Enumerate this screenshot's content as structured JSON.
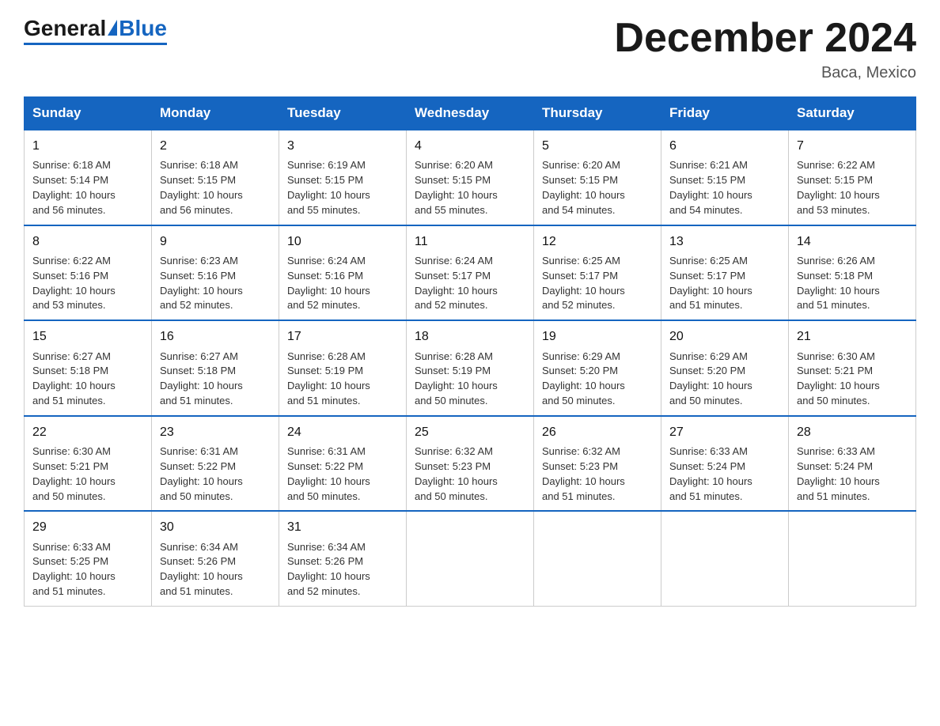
{
  "header": {
    "logo_general": "General",
    "logo_blue": "Blue",
    "month_title": "December 2024",
    "location": "Baca, Mexico"
  },
  "days_of_week": [
    "Sunday",
    "Monday",
    "Tuesday",
    "Wednesday",
    "Thursday",
    "Friday",
    "Saturday"
  ],
  "weeks": [
    [
      {
        "day": "1",
        "sunrise": "6:18 AM",
        "sunset": "5:14 PM",
        "daylight": "10 hours and 56 minutes."
      },
      {
        "day": "2",
        "sunrise": "6:18 AM",
        "sunset": "5:15 PM",
        "daylight": "10 hours and 56 minutes."
      },
      {
        "day": "3",
        "sunrise": "6:19 AM",
        "sunset": "5:15 PM",
        "daylight": "10 hours and 55 minutes."
      },
      {
        "day": "4",
        "sunrise": "6:20 AM",
        "sunset": "5:15 PM",
        "daylight": "10 hours and 55 minutes."
      },
      {
        "day": "5",
        "sunrise": "6:20 AM",
        "sunset": "5:15 PM",
        "daylight": "10 hours and 54 minutes."
      },
      {
        "day": "6",
        "sunrise": "6:21 AM",
        "sunset": "5:15 PM",
        "daylight": "10 hours and 54 minutes."
      },
      {
        "day": "7",
        "sunrise": "6:22 AM",
        "sunset": "5:15 PM",
        "daylight": "10 hours and 53 minutes."
      }
    ],
    [
      {
        "day": "8",
        "sunrise": "6:22 AM",
        "sunset": "5:16 PM",
        "daylight": "10 hours and 53 minutes."
      },
      {
        "day": "9",
        "sunrise": "6:23 AM",
        "sunset": "5:16 PM",
        "daylight": "10 hours and 52 minutes."
      },
      {
        "day": "10",
        "sunrise": "6:24 AM",
        "sunset": "5:16 PM",
        "daylight": "10 hours and 52 minutes."
      },
      {
        "day": "11",
        "sunrise": "6:24 AM",
        "sunset": "5:17 PM",
        "daylight": "10 hours and 52 minutes."
      },
      {
        "day": "12",
        "sunrise": "6:25 AM",
        "sunset": "5:17 PM",
        "daylight": "10 hours and 52 minutes."
      },
      {
        "day": "13",
        "sunrise": "6:25 AM",
        "sunset": "5:17 PM",
        "daylight": "10 hours and 51 minutes."
      },
      {
        "day": "14",
        "sunrise": "6:26 AM",
        "sunset": "5:18 PM",
        "daylight": "10 hours and 51 minutes."
      }
    ],
    [
      {
        "day": "15",
        "sunrise": "6:27 AM",
        "sunset": "5:18 PM",
        "daylight": "10 hours and 51 minutes."
      },
      {
        "day": "16",
        "sunrise": "6:27 AM",
        "sunset": "5:18 PM",
        "daylight": "10 hours and 51 minutes."
      },
      {
        "day": "17",
        "sunrise": "6:28 AM",
        "sunset": "5:19 PM",
        "daylight": "10 hours and 51 minutes."
      },
      {
        "day": "18",
        "sunrise": "6:28 AM",
        "sunset": "5:19 PM",
        "daylight": "10 hours and 50 minutes."
      },
      {
        "day": "19",
        "sunrise": "6:29 AM",
        "sunset": "5:20 PM",
        "daylight": "10 hours and 50 minutes."
      },
      {
        "day": "20",
        "sunrise": "6:29 AM",
        "sunset": "5:20 PM",
        "daylight": "10 hours and 50 minutes."
      },
      {
        "day": "21",
        "sunrise": "6:30 AM",
        "sunset": "5:21 PM",
        "daylight": "10 hours and 50 minutes."
      }
    ],
    [
      {
        "day": "22",
        "sunrise": "6:30 AM",
        "sunset": "5:21 PM",
        "daylight": "10 hours and 50 minutes."
      },
      {
        "day": "23",
        "sunrise": "6:31 AM",
        "sunset": "5:22 PM",
        "daylight": "10 hours and 50 minutes."
      },
      {
        "day": "24",
        "sunrise": "6:31 AM",
        "sunset": "5:22 PM",
        "daylight": "10 hours and 50 minutes."
      },
      {
        "day": "25",
        "sunrise": "6:32 AM",
        "sunset": "5:23 PM",
        "daylight": "10 hours and 50 minutes."
      },
      {
        "day": "26",
        "sunrise": "6:32 AM",
        "sunset": "5:23 PM",
        "daylight": "10 hours and 51 minutes."
      },
      {
        "day": "27",
        "sunrise": "6:33 AM",
        "sunset": "5:24 PM",
        "daylight": "10 hours and 51 minutes."
      },
      {
        "day": "28",
        "sunrise": "6:33 AM",
        "sunset": "5:24 PM",
        "daylight": "10 hours and 51 minutes."
      }
    ],
    [
      {
        "day": "29",
        "sunrise": "6:33 AM",
        "sunset": "5:25 PM",
        "daylight": "10 hours and 51 minutes."
      },
      {
        "day": "30",
        "sunrise": "6:34 AM",
        "sunset": "5:26 PM",
        "daylight": "10 hours and 51 minutes."
      },
      {
        "day": "31",
        "sunrise": "6:34 AM",
        "sunset": "5:26 PM",
        "daylight": "10 hours and 52 minutes."
      },
      null,
      null,
      null,
      null
    ]
  ],
  "labels": {
    "sunrise": "Sunrise:",
    "sunset": "Sunset:",
    "daylight": "Daylight:"
  }
}
